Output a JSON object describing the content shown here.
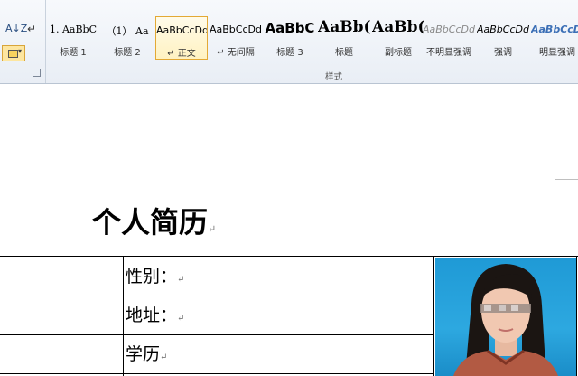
{
  "ribbon": {
    "sort_glyph": "A↓Z",
    "para_glyph": "↵",
    "group_label": "样式",
    "styles": [
      {
        "preview": "1. AaBbC",
        "label": "标题 1",
        "preview_style": "normal"
      },
      {
        "preview": "（1） Aa",
        "label": "标题 2",
        "preview_style": "normal"
      },
      {
        "preview": "AaBbCcDd",
        "label": "↵ 正文",
        "preview_style": "normal",
        "selected": true
      },
      {
        "preview": "AaBbCcDd",
        "label": "↵ 无间隔",
        "preview_style": "normal"
      },
      {
        "preview": "AaBbC",
        "label": "标题 3",
        "preview_style": "bold-large"
      },
      {
        "preview": "AaBb(",
        "label": "标题",
        "preview_style": "bold-xlarge"
      },
      {
        "preview": "AaBb(",
        "label": "副标题",
        "preview_style": "bold-xlarge"
      },
      {
        "preview": "AaBbCcDd",
        "label": "不明显强调",
        "preview_style": "italic-gray"
      },
      {
        "preview": "AaBbCcDd",
        "label": "强调",
        "preview_style": "italic"
      },
      {
        "preview": "AaBbCcDd",
        "label": "明显强调",
        "preview_style": "italic-blue"
      }
    ]
  },
  "document": {
    "title": "个人简历",
    "rows": [
      {
        "label": "性别：",
        "mark": "↵"
      },
      {
        "label": "地址：",
        "mark": "↵"
      },
      {
        "label": "学历",
        "mark": "↵"
      }
    ]
  },
  "colors": {
    "selected_border": "#e3a935",
    "photo_background": "#2aa3dd",
    "accent_blue": "#3b6fb6"
  }
}
